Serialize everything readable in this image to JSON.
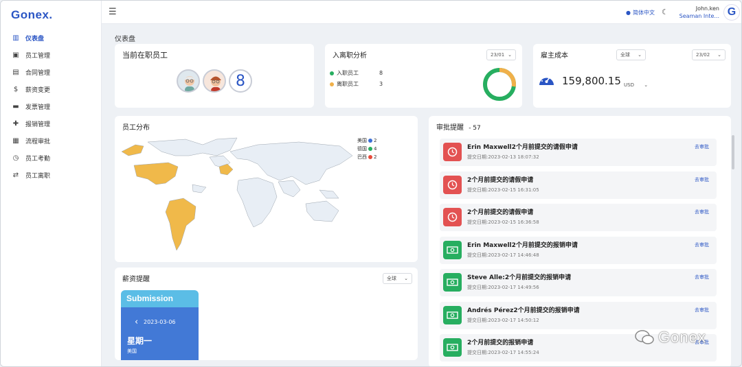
{
  "app": {
    "logo": "Gonex."
  },
  "sidebar": {
    "items": [
      {
        "label": "仪表盘",
        "icon": "bar-chart-icon",
        "glyph": "▥",
        "active": true
      },
      {
        "label": "员工管理",
        "icon": "user-card-icon",
        "glyph": "▣"
      },
      {
        "label": "合同管理",
        "icon": "document-icon",
        "glyph": "▤"
      },
      {
        "label": "薪资变更",
        "icon": "dollar-icon",
        "glyph": "$"
      },
      {
        "label": "发票管理",
        "icon": "briefcase-icon",
        "glyph": "▬"
      },
      {
        "label": "报销管理",
        "icon": "pin-icon",
        "glyph": "✚"
      },
      {
        "label": "流程审批",
        "icon": "id-card-icon",
        "glyph": "▦"
      },
      {
        "label": "员工考勤",
        "icon": "clock-icon",
        "glyph": "◷"
      },
      {
        "label": "员工离职",
        "icon": "swap-icon",
        "glyph": "⇄"
      }
    ]
  },
  "header": {
    "language": "简体中文",
    "user_name": "John.ken",
    "user_org": "Seaman Inte...",
    "avatar_letter": "G"
  },
  "page_title": "仪表盘",
  "current_staff": {
    "title": "当前在职员工",
    "count": "8"
  },
  "entry_exit": {
    "title": "入离职分析",
    "select": "23/01",
    "rows": [
      {
        "label": "入职员工",
        "value": "8",
        "color": "#27ae60"
      },
      {
        "label": "离职员工",
        "value": "3",
        "color": "#f0b04a"
      }
    ]
  },
  "employer_cost": {
    "title": "雇主成本",
    "region_select": "全球",
    "date_select": "23/02",
    "amount": "159,800.15",
    "currency": "USD"
  },
  "distribution": {
    "title": "员工分布",
    "legend": [
      {
        "label": "美国",
        "value": "2",
        "color": "#3b6fd6"
      },
      {
        "label": "德国",
        "value": "4",
        "color": "#27ae60"
      },
      {
        "label": "巴西",
        "value": "2",
        "color": "#e74c3c"
      }
    ]
  },
  "salary": {
    "title": "薪资提醒",
    "select": "全球",
    "banner": "Submission",
    "date": "2023-03-06",
    "weekday": "星期一",
    "country": "美国"
  },
  "approvals": {
    "title": "审批提醒",
    "count": "- 57",
    "items": [
      {
        "title": "Erin Maxwell2个月前提交的请假申请",
        "date": "提交日期:2023-02-13 18:07:32",
        "type": "leave",
        "link": "去审批"
      },
      {
        "title": "2个月前提交的请假申请",
        "date": "提交日期:2023-02-15 16:31:05",
        "type": "leave",
        "link": "去审批"
      },
      {
        "title": "2个月前提交的请假申请",
        "date": "提交日期:2023-02-15 16:36:58",
        "type": "leave",
        "link": "去审批"
      },
      {
        "title": "Erin Maxwell2个月前提交的报销申请",
        "date": "提交日期:2023-02-17 14:46:48",
        "type": "expense",
        "link": "去审批"
      },
      {
        "title": "Steve Alle:2个月前提交的报销申请",
        "date": "提交日期:2023-02-17 14:49:56",
        "type": "expense",
        "link": "去审批"
      },
      {
        "title": "Andrés Pérez2个月前提交的报销申请",
        "date": "提交日期:2023-02-17 14:50:12",
        "type": "expense",
        "link": "去审批"
      },
      {
        "title": "2个月前提交的报销申请",
        "date": "提交日期:2023-02-17 14:55:24",
        "type": "expense",
        "link": "去审批"
      }
    ]
  },
  "watermark": "Gonex"
}
